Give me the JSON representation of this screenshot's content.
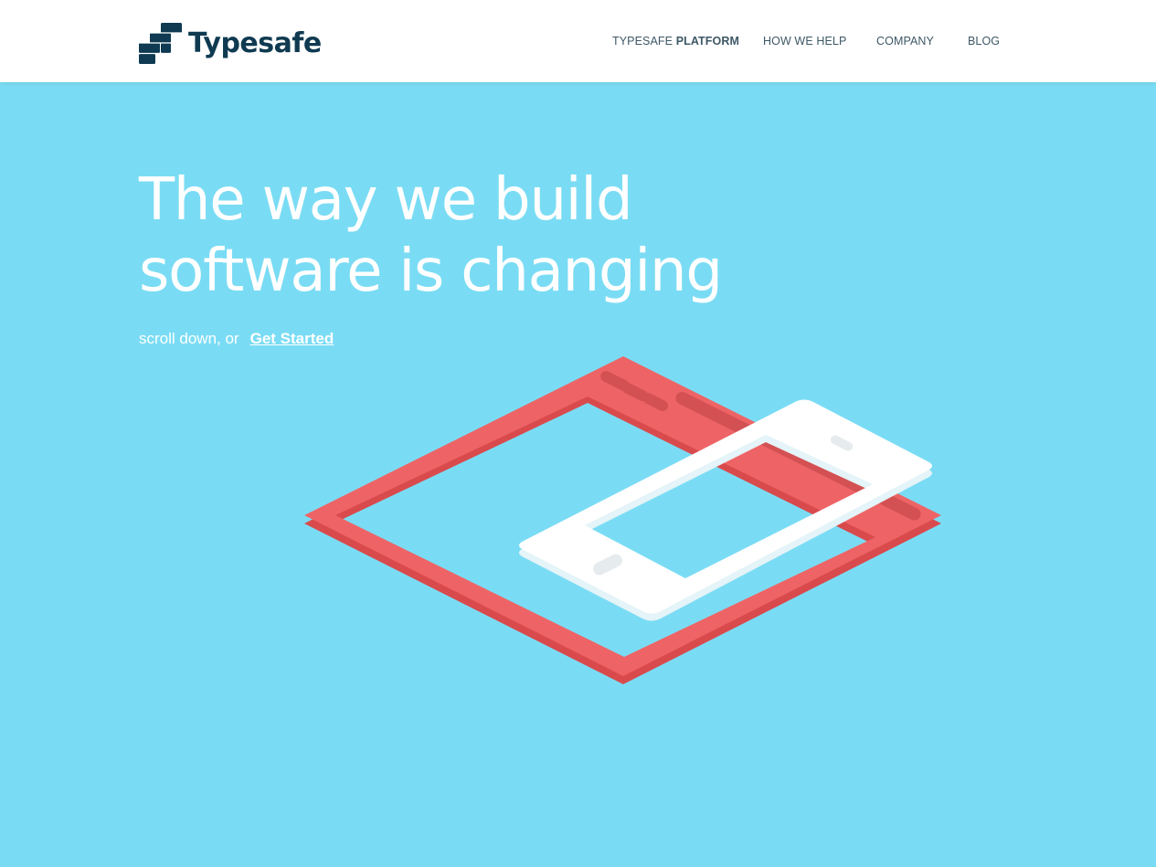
{
  "brand": {
    "name": "Typesafe",
    "logo_icon": "typesafe-logo-icon",
    "color": "#0f3a51"
  },
  "nav": {
    "platform_prefix": "TYPESAFE",
    "platform_bold": "PLATFORM",
    "how_we_help": "HOW WE HELP",
    "company": "COMPANY",
    "blog": "BLOG"
  },
  "hero": {
    "title_line1": "The way we build",
    "title_line2": "software is changing",
    "subline": "scroll down, or",
    "cta_label": "Get Started",
    "illustration": "tablet-and-phone-illustration"
  },
  "colors": {
    "background": "#7adcf4",
    "header_bg": "#ffffff",
    "tablet": "#ee6466",
    "tablet_shadow": "#d94a4d",
    "phone": "#ffffff",
    "nav_text": "#3e5866"
  }
}
